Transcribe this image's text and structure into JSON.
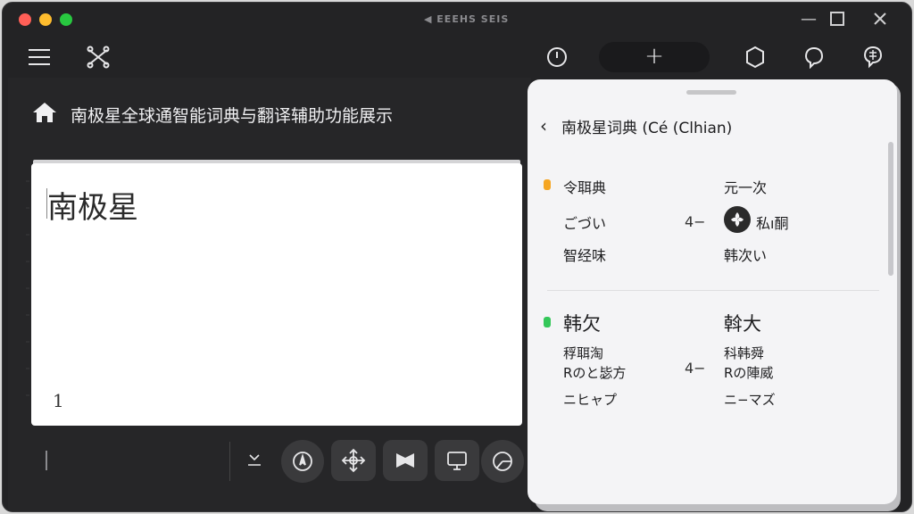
{
  "window": {
    "app_title": "◀ EEEHS SEIS"
  },
  "toolbar": {
    "add_label": "+"
  },
  "main": {
    "page_title": "南极星全球通智能词典与翻译辅助功能展示",
    "editor_text": "南极星",
    "editor_count": "1"
  },
  "panel": {
    "back": "‹",
    "title": "南极星词典 (Cé (Clhian)",
    "entry1": {
      "left": [
        "令聑典",
        "ごづい",
        "智经味"
      ],
      "middle": "4−",
      "right": [
        "元一次",
        "私ı酮",
        "韩次い"
      ]
    },
    "entry2": {
      "left": [
        "韩欠",
        "稃聑淘",
        "Rのと毖方",
        "ニヒャプ"
      ],
      "middle": "4−",
      "right": [
        "斡大",
        "科韩舜",
        "Rの陣威",
        "ニ−マズ"
      ]
    }
  },
  "colors": {
    "accent_orange": "#f5a623",
    "accent_green": "#34c759"
  }
}
